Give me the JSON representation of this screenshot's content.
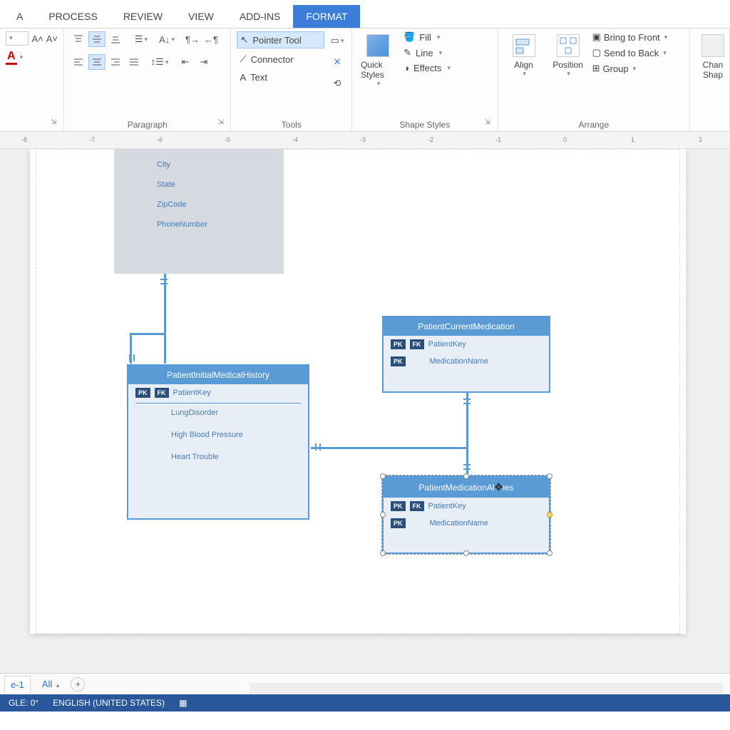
{
  "tabs": [
    "A",
    "PROCESS",
    "REVIEW",
    "VIEW",
    "ADD-INS",
    "FORMAT"
  ],
  "active_tab": "FORMAT",
  "ribbon": {
    "font": {
      "size": "",
      "grow": "A˄",
      "shrink": "A˅"
    },
    "paragraph": {
      "label": "Paragraph"
    },
    "tools": {
      "label": "Tools",
      "pointer": "Pointer Tool",
      "connector": "Connector",
      "text": "Text"
    },
    "shape_styles": {
      "label": "Shape Styles",
      "quick": "Quick Styles",
      "fill": "Fill",
      "line": "Line",
      "effects": "Effects"
    },
    "arrange": {
      "label": "Arrange",
      "align": "Align",
      "position": "Position",
      "bring_front": "Bring to Front",
      "send_back": "Send to Back",
      "group": "Group"
    },
    "change_shape_1": "Chan",
    "change_shape_2": "Shap"
  },
  "ruler_ticks": [
    "-8",
    "-7",
    "-6",
    "-5",
    "-4",
    "-3",
    "-2",
    "-1",
    "0",
    "1",
    "2"
  ],
  "canvas": {
    "top_entity": {
      "fields": [
        "City",
        "State",
        "ZipCode",
        "PhoneNumber"
      ]
    },
    "entity1": {
      "title": "PatientInitialMedicalHistory",
      "key_field": "PatientKey",
      "fields": [
        "LungDisorder",
        "High Blood Pressure",
        "Heart Trouble"
      ]
    },
    "entity2": {
      "title": "PatientCurrentMedication",
      "rows": [
        {
          "keys": [
            "PK",
            "FK"
          ],
          "field": "PatientKey"
        },
        {
          "keys": [
            "PK"
          ],
          "field": "MedicationName"
        }
      ]
    },
    "entity3": {
      "title_pre": "PatientMedicationAl",
      "title_post": "ies",
      "rows": [
        {
          "keys": [
            "PK",
            "FK"
          ],
          "field": "PatientKey"
        },
        {
          "keys": [
            "PK"
          ],
          "field": "MedicationName"
        }
      ]
    }
  },
  "page_tabs": {
    "current": "e-1",
    "all": "All",
    "add": "+"
  },
  "status": {
    "angle": "GLE: 0°",
    "lang": "ENGLISH (UNITED STATES)"
  }
}
